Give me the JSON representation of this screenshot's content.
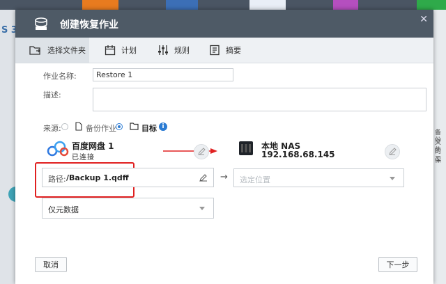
{
  "window": {
    "title": "创建恢复作业"
  },
  "steps": [
    {
      "label": "选择文件夹",
      "icon": "folder-select-icon"
    },
    {
      "label": "计划",
      "icon": "calendar-icon"
    },
    {
      "label": "规则",
      "icon": "sliders-icon"
    },
    {
      "label": "摘要",
      "icon": "summary-icon"
    }
  ],
  "form": {
    "job_name_label": "作业名称:",
    "job_name_value": "Restore 1",
    "description_label": "描述:",
    "description_value": "",
    "source_label": "来源:",
    "source_option_backup": "备份作业",
    "source_option_target": "目标",
    "selected_source": "目标"
  },
  "cloud": {
    "name": "百度网盘 1",
    "account": "已连接",
    "path_label": "路径:",
    "path_value": "/Backup 1.qdff",
    "mode_value": "仅元数据"
  },
  "nas": {
    "name": "本地 NAS",
    "ip": "192.168.68.145",
    "location_placeholder": "选定位置"
  },
  "footer": {
    "cancel_label": "取消",
    "next_label": "下一步"
  },
  "background": {
    "left_label": "S 3",
    "right_lines": [
      "备份",
      "文件",
      "的工",
      "保"
    ]
  },
  "colors": {
    "titlebar": "#4e5a66",
    "accent_red": "#e02020",
    "accent_blue": "#2b7bd3"
  }
}
